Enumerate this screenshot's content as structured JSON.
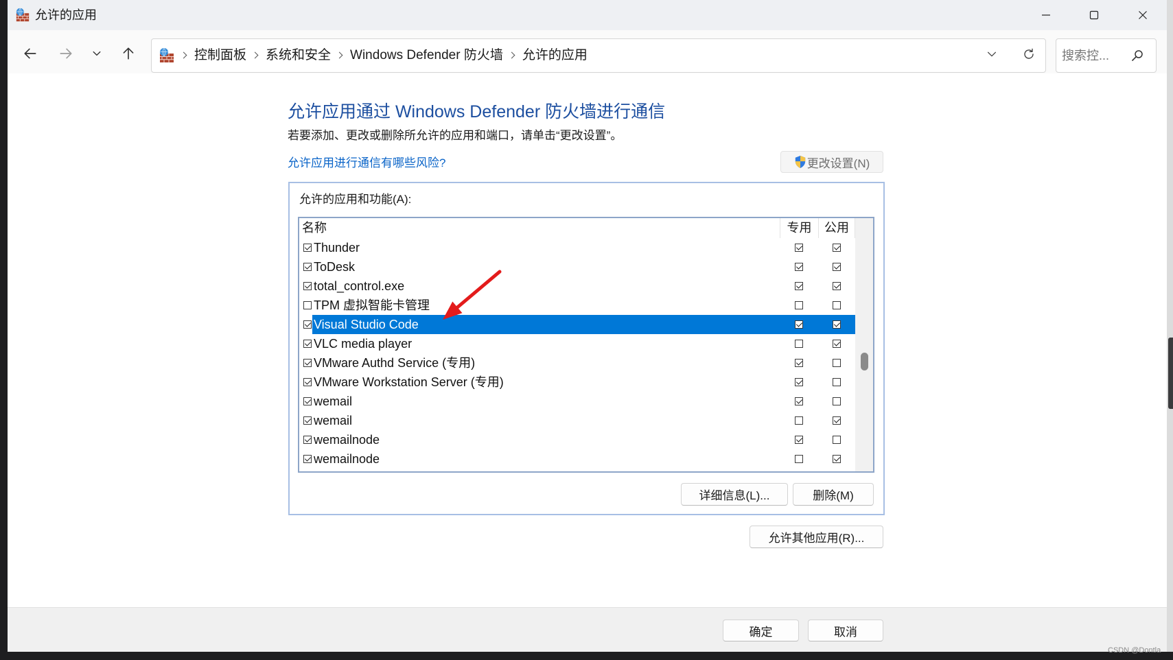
{
  "window": {
    "title": "允许的应用",
    "icon": "firewall-icon",
    "controls": [
      "minimize-icon",
      "maximize-icon",
      "close-icon"
    ]
  },
  "nav": {
    "back_icon": "arrow-left-icon",
    "forward_icon": "arrow-right-icon",
    "recent_icon": "chevron-down-icon",
    "up_icon": "arrow-up-icon"
  },
  "address": {
    "icon": "firewall-icon",
    "breadcrumb": [
      "控制面板",
      "系统和安全",
      "Windows Defender 防火墙",
      "允许的应用"
    ],
    "history_icon": "chevron-down-icon",
    "refresh_icon": "refresh-icon"
  },
  "search": {
    "placeholder": "搜索控...",
    "icon": "search-icon"
  },
  "main": {
    "heading": "允许应用通过 Windows Defender 防火墙进行通信",
    "description": "若要添加、更改或删除所允许的应用和端口，请单击“更改设置”。",
    "risk_link": "允许应用进行通信有哪些风险?",
    "change_settings": {
      "label": "更改设置(N)",
      "icon": "uac-shield-icon",
      "enabled": false
    }
  },
  "apps": {
    "label": "允许的应用和功能(A):",
    "columns": {
      "name": "名称",
      "private": "专用",
      "public": "公用"
    },
    "rows": [
      {
        "name": "Thunder",
        "enabled": true,
        "private": true,
        "public": true
      },
      {
        "name": "ToDesk",
        "enabled": true,
        "private": true,
        "public": true
      },
      {
        "name": "total_control.exe",
        "enabled": true,
        "private": true,
        "public": true
      },
      {
        "name": "TPM 虚拟智能卡管理",
        "enabled": false,
        "private": false,
        "public": false
      },
      {
        "name": "Visual Studio Code",
        "enabled": true,
        "private": true,
        "public": true,
        "selected": true
      },
      {
        "name": "VLC media player",
        "enabled": true,
        "private": false,
        "public": true
      },
      {
        "name": "VMware Authd Service (专用)",
        "enabled": true,
        "private": true,
        "public": false
      },
      {
        "name": "VMware Workstation Server (专用)",
        "enabled": true,
        "private": true,
        "public": false
      },
      {
        "name": "wemail",
        "enabled": true,
        "private": true,
        "public": false
      },
      {
        "name": "wemail",
        "enabled": true,
        "private": false,
        "public": true
      },
      {
        "name": "wemailnode",
        "enabled": true,
        "private": true,
        "public": false
      },
      {
        "name": "wemailnode",
        "enabled": true,
        "private": false,
        "public": true
      }
    ],
    "scrollbar": {
      "position": 0.57
    },
    "details_label": "详细信息(L)...",
    "remove_label": "删除(M)"
  },
  "allow_another_label": "允许其他应用(R)...",
  "footer": {
    "ok_label": "确定",
    "cancel_label": "取消"
  },
  "watermark": "CSDN @Dontla",
  "annotation": {
    "icon": "red-arrow-icon"
  },
  "colors": {
    "accent": "#0078d7",
    "heading": "#1d4fa0",
    "link": "#0a64c8",
    "annotation": "#e31b1b",
    "group_border": "#a7bfe4"
  }
}
